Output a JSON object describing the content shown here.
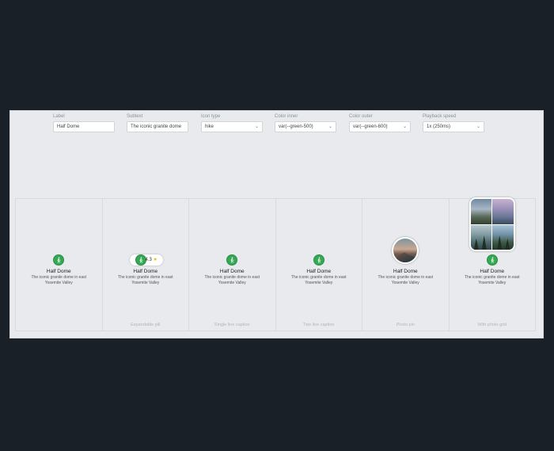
{
  "controls": [
    {
      "label": "Label",
      "value": "Half Dome",
      "type": "text"
    },
    {
      "label": "Subtext",
      "value": "The iconic granite dome",
      "type": "text"
    },
    {
      "label": "Icon type",
      "value": "hike",
      "type": "select"
    },
    {
      "label": "Color inner",
      "value": "var(--green-500)",
      "type": "select"
    },
    {
      "label": "Color outer",
      "value": "var(--green-600)",
      "type": "select"
    },
    {
      "label": "Playback speed",
      "value": "1x (250ms)",
      "type": "select"
    }
  ],
  "marker": {
    "title": "Half Dome",
    "subtext": "The iconic granite dome in east Yosemite Valley",
    "rating": "4.3",
    "star": "★",
    "icon": "hike-icon",
    "inner_color": "#34a853",
    "outer_color": "#2d8f47"
  },
  "variants": [
    {
      "caption": ""
    },
    {
      "caption": "Expandable pill"
    },
    {
      "caption": "Single line caption"
    },
    {
      "caption": "Two line caption"
    },
    {
      "caption": "Photo pin"
    },
    {
      "caption": "With photo grid"
    }
  ],
  "chevron": "⌄"
}
